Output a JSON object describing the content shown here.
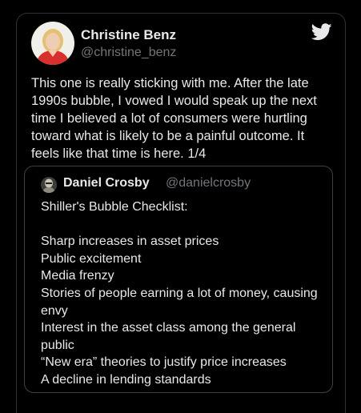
{
  "tweet": {
    "author_name": "Christine Benz",
    "author_handle": "@christine_benz",
    "text": "This one is really sticking with me. After the late 1990s bubble, I vowed I would speak up the next time I believed a lot of consumers were hurtling toward what is likely to be a painful outcome. It feels like that time is here. 1/4",
    "logo_icon": "twitter-bird-icon"
  },
  "quote": {
    "author_name": "Daniel Crosby",
    "author_handle": "@danielcrosby",
    "lines": [
      "Shiller's Bubble Checklist:",
      "",
      "Sharp increases in asset prices",
      "Public excitement",
      "Media frenzy",
      "Stories of people earning a lot of money, causing envy",
      "Interest in the asset class among the general public",
      "“New era” theories to justify price increases",
      "A decline in lending standards"
    ]
  },
  "colors": {
    "background": "#000000",
    "text": "#e7e9ea",
    "secondary_text": "#71767b",
    "border": "#2f3336",
    "twitter_logo": "#e7e9ea"
  }
}
